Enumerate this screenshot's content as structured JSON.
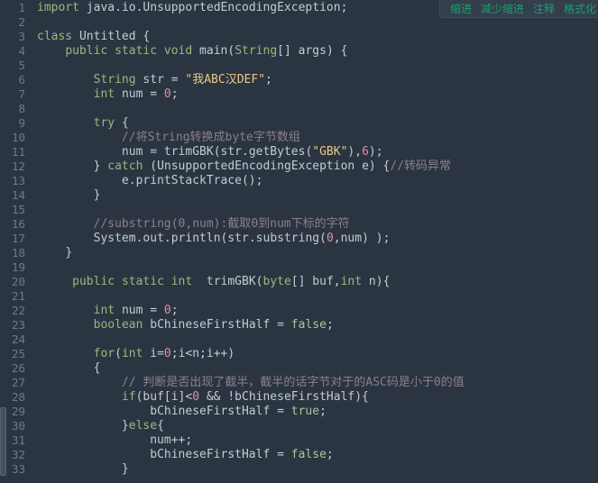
{
  "toolbar": {
    "items": [
      {
        "label": "缩进"
      },
      {
        "label": "减少缩进"
      },
      {
        "label": "注释"
      },
      {
        "label": "格式化"
      }
    ]
  },
  "editor": {
    "theme_background": "#2b3542",
    "gutter_color": "#6b7b8c",
    "fold_glyph": "▾",
    "lines": [
      {
        "num": "1",
        "fold": false
      },
      {
        "num": "2",
        "fold": false
      },
      {
        "num": "3",
        "fold": true
      },
      {
        "num": "4",
        "fold": true
      },
      {
        "num": "5",
        "fold": false
      },
      {
        "num": "6",
        "fold": false
      },
      {
        "num": "7",
        "fold": false
      },
      {
        "num": "8",
        "fold": false
      },
      {
        "num": "9",
        "fold": true
      },
      {
        "num": "10",
        "fold": false
      },
      {
        "num": "11",
        "fold": false
      },
      {
        "num": "12",
        "fold": true
      },
      {
        "num": "13",
        "fold": false
      },
      {
        "num": "14",
        "fold": false
      },
      {
        "num": "15",
        "fold": false
      },
      {
        "num": "16",
        "fold": false
      },
      {
        "num": "17",
        "fold": false
      },
      {
        "num": "18",
        "fold": false
      },
      {
        "num": "19",
        "fold": false
      },
      {
        "num": "20",
        "fold": true
      },
      {
        "num": "21",
        "fold": false
      },
      {
        "num": "22",
        "fold": false
      },
      {
        "num": "23",
        "fold": false
      },
      {
        "num": "24",
        "fold": false
      },
      {
        "num": "25",
        "fold": false
      },
      {
        "num": "26",
        "fold": true
      },
      {
        "num": "27",
        "fold": false
      },
      {
        "num": "28",
        "fold": true
      },
      {
        "num": "29",
        "fold": false
      },
      {
        "num": "30",
        "fold": true
      },
      {
        "num": "31",
        "fold": false
      },
      {
        "num": "32",
        "fold": false
      },
      {
        "num": "33",
        "fold": false
      }
    ],
    "code": [
      "import java.io.UnsupportedEncodingException;",
      "",
      "class Untitled {",
      "    public static void main(String[] args) {",
      "",
      "        String str = \"我ABC汉DEF\";",
      "        int num = 0;",
      "",
      "        try {",
      "            //将String转换成byte字节数组",
      "            num = trimGBK(str.getBytes(\"GBK\"),6);",
      "        } catch (UnsupportedEncodingException e) {//转码异常",
      "            e.printStackTrace();",
      "        }",
      "",
      "        //substring(0,num):截取0到num下标的字符",
      "        System.out.println(str.substring(0,num) );",
      "    }",
      "",
      "     public static int  trimGBK(byte[] buf,int n){",
      "",
      "        int num = 0;",
      "        boolean bChineseFirstHalf = false;",
      "",
      "        for(int i=0;i<n;i++)",
      "        {",
      "            // 判断是否出现了截半，截半的话字节对于的ASC码是小于0的值",
      "            if(buf[i]<0 && !bChineseFirstHalf){",
      "                bChineseFirstHalf = true;",
      "            }else{",
      "                num++;",
      "                bChineseFirstHalf = false;",
      "            }"
    ]
  }
}
